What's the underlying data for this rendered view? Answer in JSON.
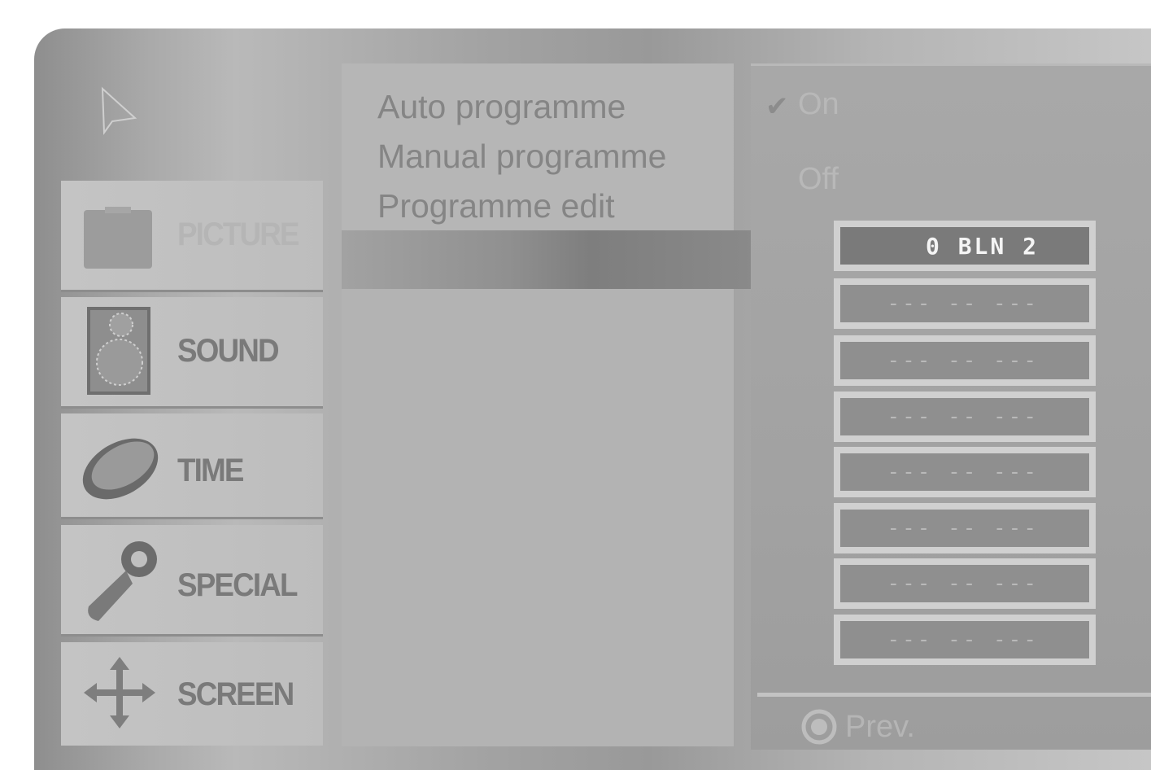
{
  "menu": {
    "categories": [
      {
        "label": "PICTURE",
        "icon": "picture-icon",
        "active": false
      },
      {
        "label": "SOUND",
        "icon": "speaker-icon",
        "active": true
      },
      {
        "label": "TIME",
        "icon": "clock-icon",
        "active": true
      },
      {
        "label": "SPECIAL",
        "icon": "key-icon",
        "active": true
      },
      {
        "label": "SCREEN",
        "icon": "move-arrows-icon",
        "active": true
      }
    ]
  },
  "submenu": {
    "items": [
      "Auto programme",
      "Manual programme",
      "Programme edit"
    ]
  },
  "options": {
    "on": "On",
    "off": "Off",
    "selected": "On"
  },
  "programme_slots": [
    "0 BLN 2",
    "--- -- ---",
    "--- -- ---",
    "--- -- ---",
    "--- -- ---",
    "--- -- ---",
    "--- -- ---",
    "--- -- ---"
  ],
  "footer": {
    "prev_label": "Prev."
  },
  "colors": {
    "frame": "#a9a9a9",
    "panel": "#b6b6b6",
    "slot_active": "#7a7a7a",
    "label_gray": "#7a7a7a"
  }
}
